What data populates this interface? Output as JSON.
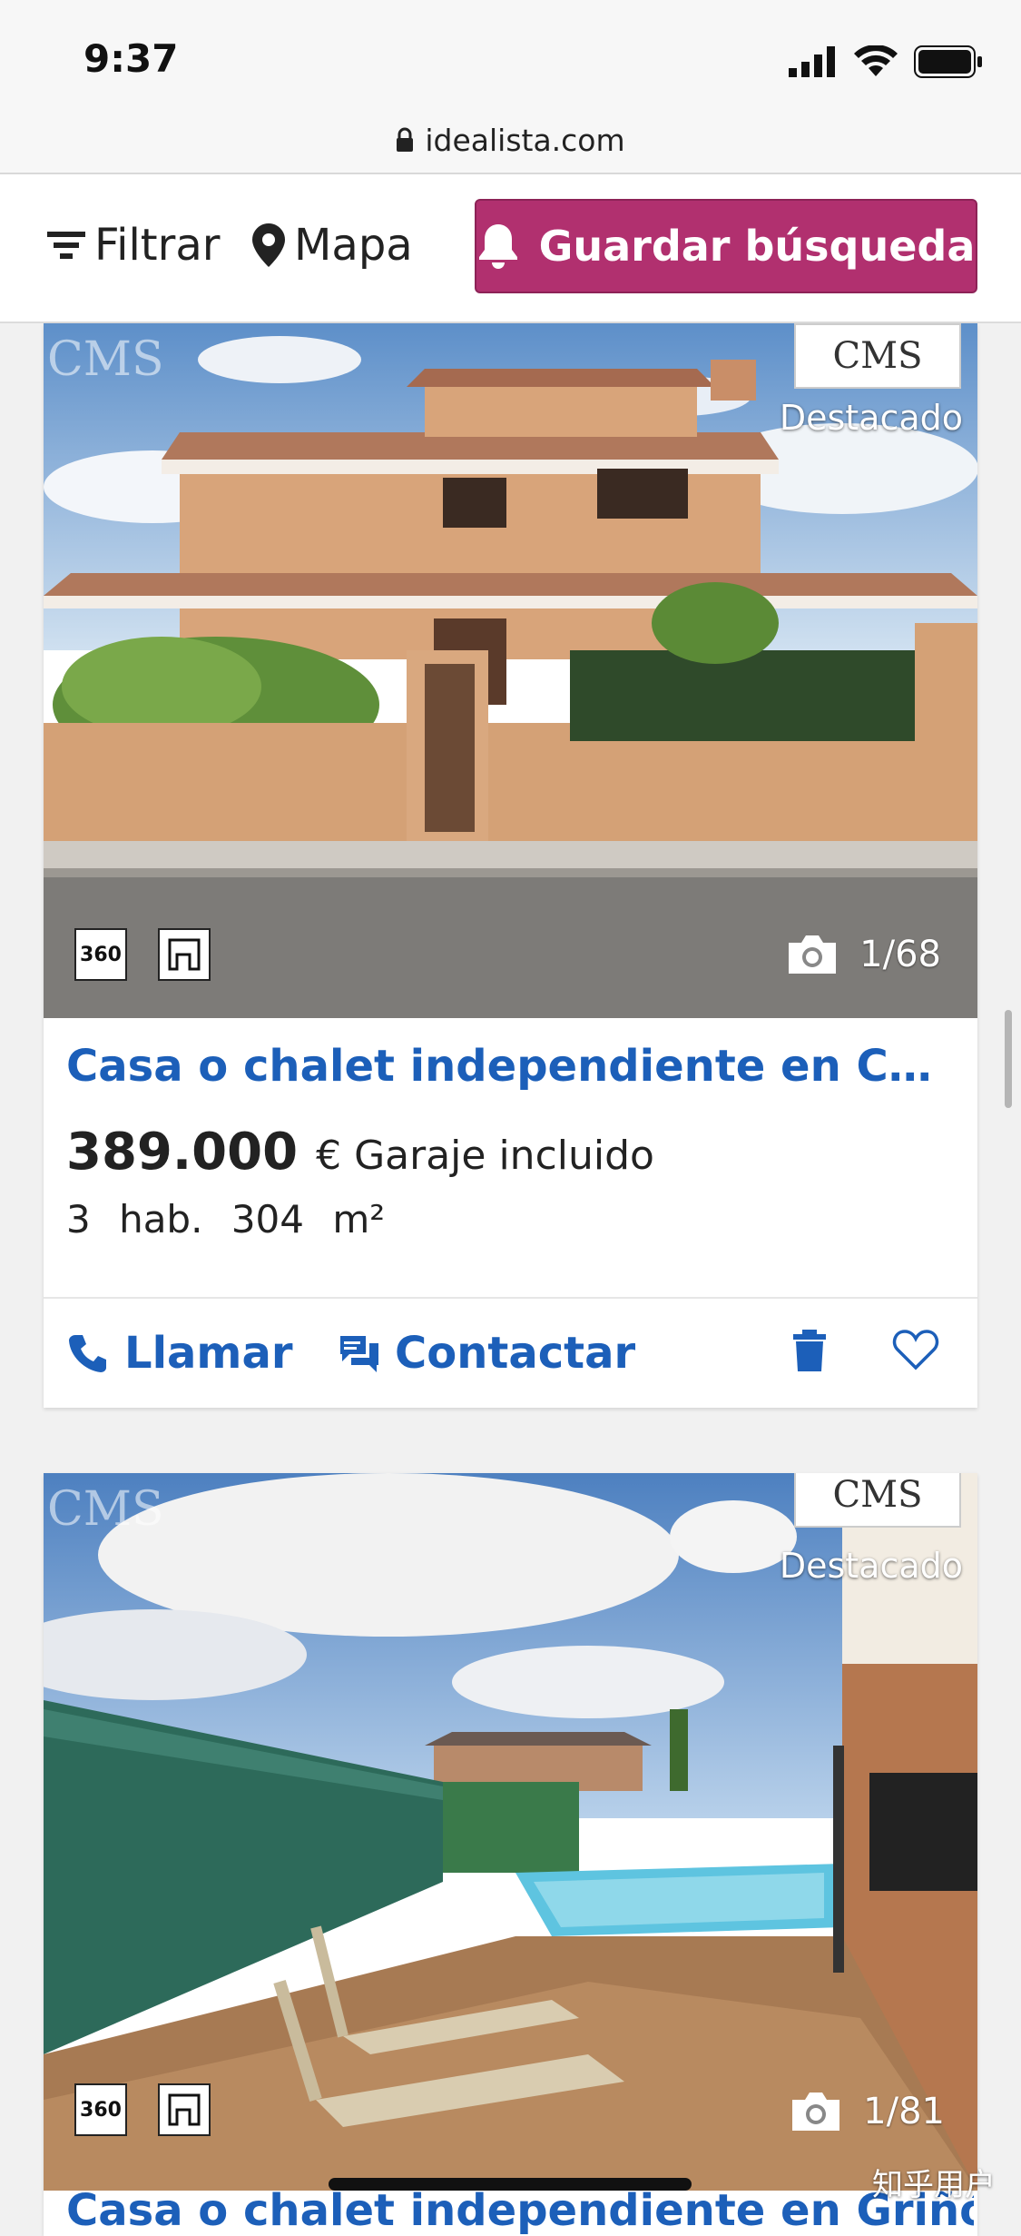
{
  "status": {
    "time": "9:37"
  },
  "browser": {
    "url": "idealista.com"
  },
  "toolbar": {
    "filter_label": "Filtrar",
    "map_label": "Mapa",
    "save_search_label": "Guardar búsqueda",
    "accent_color": "#b1306f"
  },
  "listings": [
    {
      "badge_text": "CMS",
      "featured_label": "Destacado",
      "tour_label": "360",
      "photo_counter": "1/68",
      "title": "Casa o chalet independiente en Cubas ...",
      "price": "389.000",
      "currency": "€",
      "extra": "Garaje incluido",
      "rooms": "3 hab.",
      "area": "304 m²",
      "call_label": "Llamar",
      "contact_label": "Contactar"
    },
    {
      "badge_text": "CMS",
      "featured_label": "Destacado",
      "tour_label": "360",
      "photo_counter": "1/81",
      "title": "Casa o chalet independiente en Griñón"
    }
  ],
  "watermark": "知乎用户",
  "colors": {
    "link": "#1c5fb9",
    "accent": "#b1306f"
  }
}
